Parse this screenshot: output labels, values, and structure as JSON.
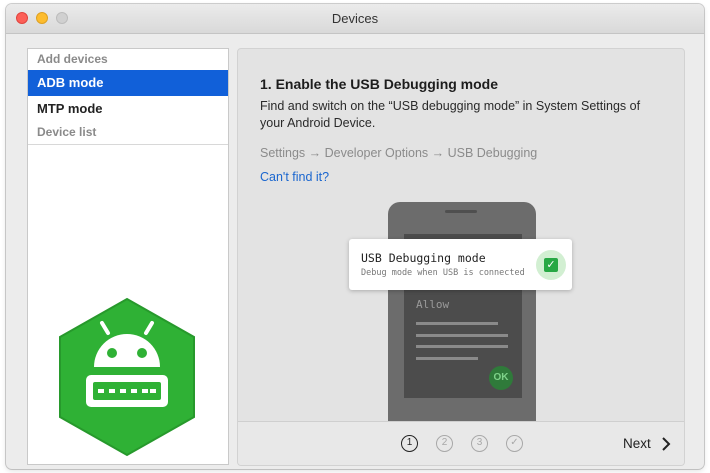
{
  "window": {
    "title": "Devices"
  },
  "sidebar": {
    "sections": [
      {
        "header": "Add devices",
        "items": [
          {
            "label": "ADB mode",
            "selected": true
          },
          {
            "label": "MTP mode",
            "selected": false
          }
        ]
      },
      {
        "header": "Device list",
        "items": []
      }
    ]
  },
  "step": {
    "title": "1. Enable the USB Debugging mode",
    "description": "Find and switch on the “USB debugging mode” in System Settings of your Android Device.",
    "path": "Settings → Developer Options → USB Debugging",
    "help_link": "Can't find it?"
  },
  "illustration": {
    "popup_title": "USB Debugging mode",
    "popup_subtitle": "Debug mode when USB is connected",
    "allow_label": "Allow",
    "ok_label": "OK"
  },
  "footer": {
    "steps": [
      "1",
      "2",
      "3",
      "✓"
    ],
    "current_step": 1,
    "next_label": "Next"
  },
  "colors": {
    "selection": "#1160d9",
    "link": "#1a66cf",
    "logo_green": "#2fb135",
    "check_green": "#27a844"
  },
  "icons": [
    "android-usb-logo-icon",
    "checkbox-checked-icon",
    "chevron-right-icon",
    "checkmark-icon"
  ]
}
